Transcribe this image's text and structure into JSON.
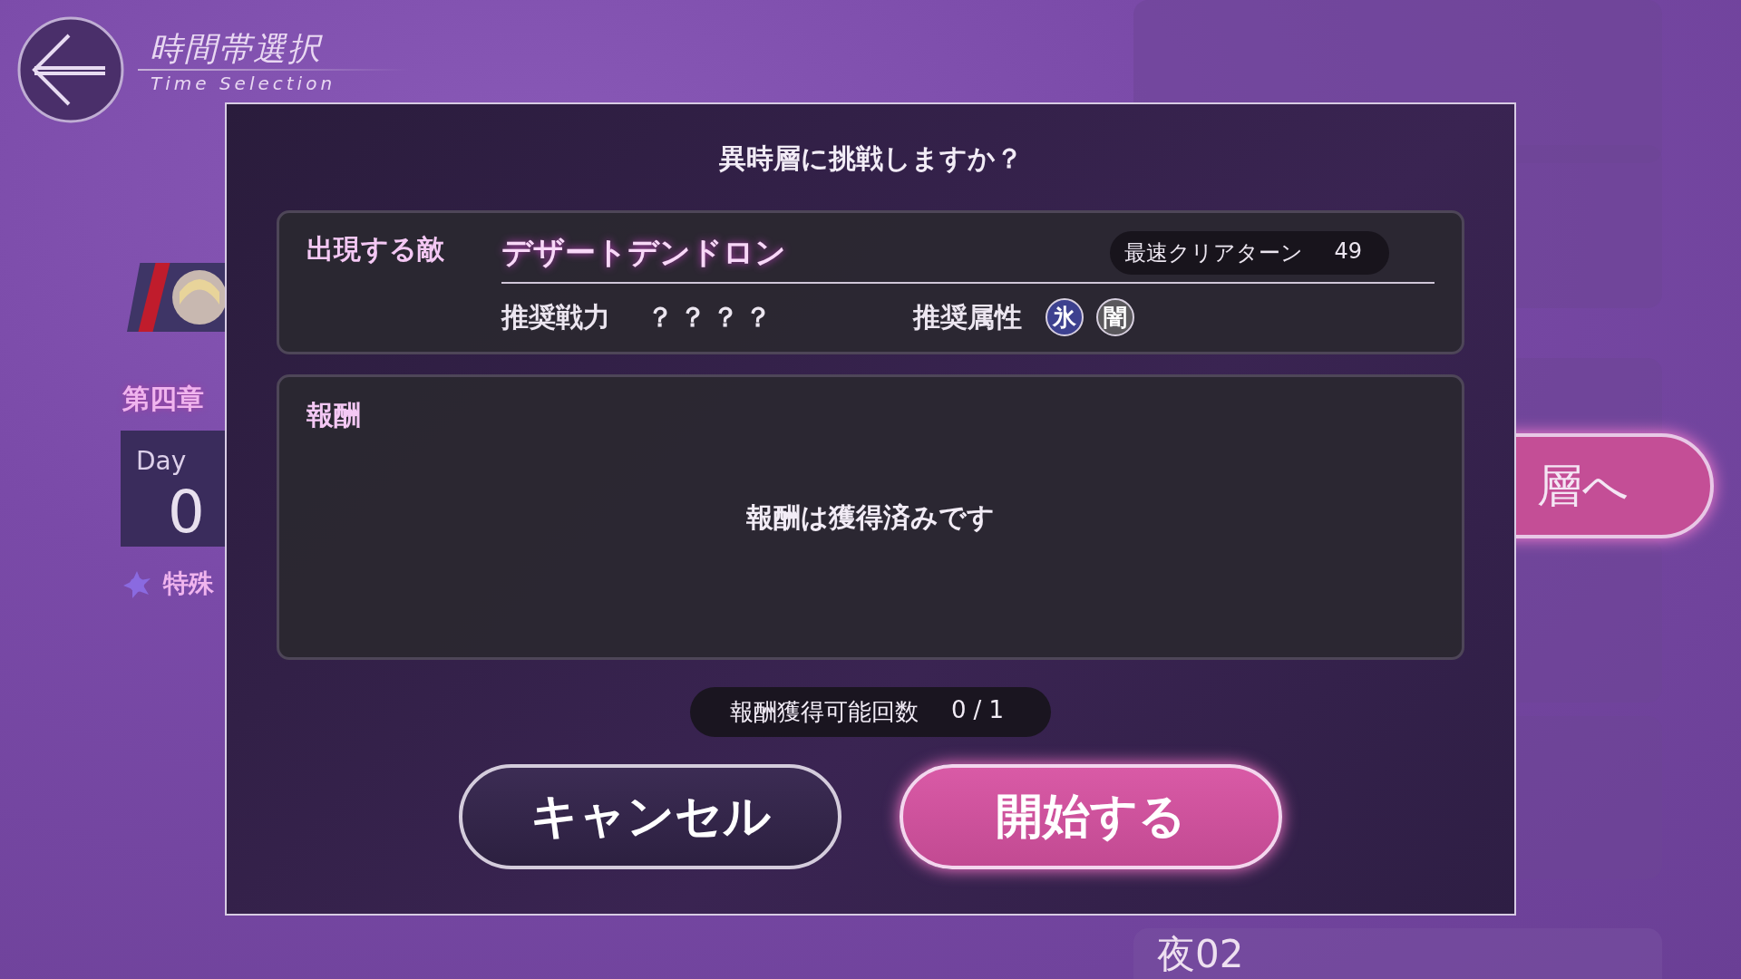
{
  "header": {
    "title": "時間帯選択",
    "subtitle": "Time Selection"
  },
  "left_panel": {
    "chapter": "第四章",
    "day_label": "Day",
    "day_number": "0",
    "special_label": "特殊"
  },
  "right_panel": {
    "button_label": "層へ",
    "card_label": "夜02"
  },
  "dialog": {
    "title": "異時層に挑戦しますか？",
    "enemy_label": "出現する敵",
    "enemy_name": "デザートデンドロン",
    "fastest_clear": {
      "label": "最速クリアターン",
      "value": "49"
    },
    "power_label": "推奨戦力",
    "power_value": "？？？？",
    "attribute_label": "推奨属性",
    "attributes": [
      {
        "label": "氷",
        "color": "#3d418f"
      },
      {
        "label": "闇",
        "color": "#5a585c"
      }
    ],
    "rewards_label": "報酬",
    "rewards_message": "報酬は獲得済みです",
    "reward_count": {
      "label": "報酬獲得可能回数",
      "value": "0/1"
    },
    "buttons": [
      {
        "label": "キャンセル",
        "kind": "secondary"
      },
      {
        "label": "開始する",
        "kind": "primary"
      }
    ]
  }
}
